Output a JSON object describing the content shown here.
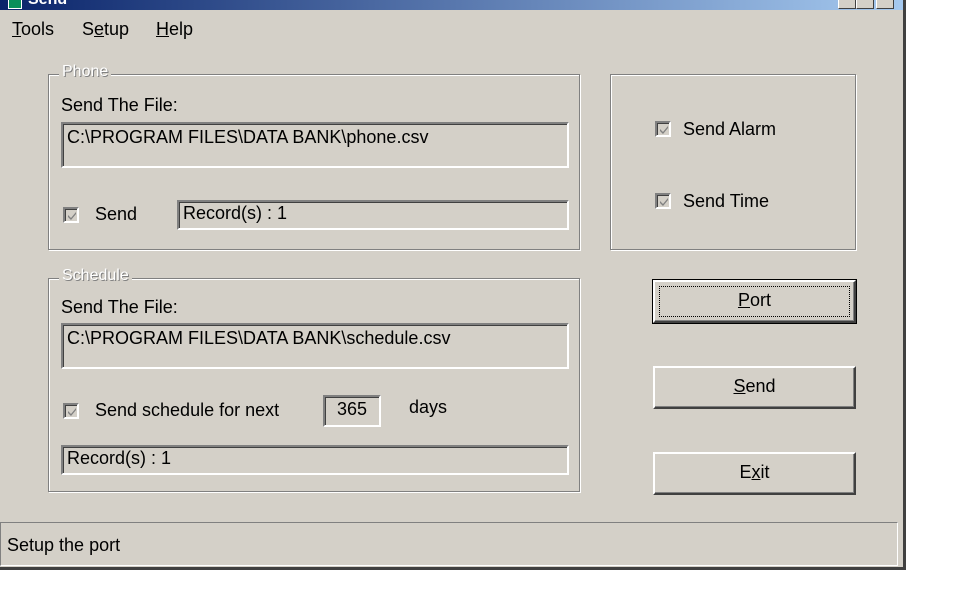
{
  "window": {
    "title": "Send",
    "app_icon": "phone-icon",
    "caption_buttons": [
      "minimize-icon",
      "maximize-icon",
      "close-icon"
    ]
  },
  "menu": {
    "tools": {
      "mnemonic": "T",
      "rest": "ools"
    },
    "setup": {
      "pre": "S",
      "mnemonic": "e",
      "rest": "tup"
    },
    "help": {
      "mnemonic": "H",
      "rest": "elp"
    }
  },
  "phone": {
    "legend": "Phone",
    "send_file_label": "Send The File:",
    "file_path": "C:\\PROGRAM FILES\\DATA BANK\\phone.csv",
    "send_label": "Send",
    "send_checked": true,
    "records": "Record(s) : 1"
  },
  "schedule": {
    "legend": "Schedule",
    "send_file_label": "Send The File:",
    "file_path": "C:\\PROGRAM FILES\\DATA BANK\\schedule.csv",
    "send_label": "Send schedule for next",
    "send_checked": true,
    "days_value": "365",
    "days_label": "days",
    "records": "Record(s) : 1"
  },
  "options": {
    "send_alarm": "Send Alarm",
    "send_alarm_checked": true,
    "send_time": "Send Time",
    "send_time_checked": true
  },
  "buttons": {
    "port": {
      "mnemonic": "P",
      "rest": "ort"
    },
    "send": {
      "mnemonic": "S",
      "rest": "end"
    },
    "exit": {
      "pre": "E",
      "mnemonic": "x",
      "rest": "it"
    }
  },
  "status": "Setup the port",
  "colors": {
    "face": "#d4d0c8",
    "titlebar": "#0a246a",
    "disabled_text": "#808080"
  }
}
